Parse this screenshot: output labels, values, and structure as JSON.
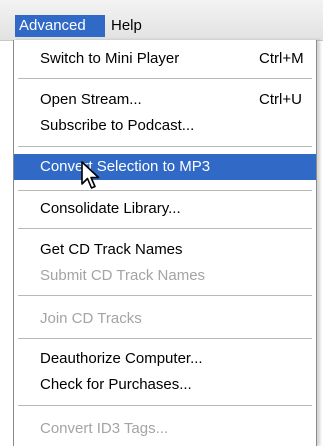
{
  "menubar": {
    "items": [
      {
        "label": "Advanced",
        "active": true
      },
      {
        "label": "Help",
        "active": false
      }
    ]
  },
  "menu": {
    "items": [
      {
        "label": "Switch to Mini Player",
        "shortcut": "Ctrl+M",
        "enabled": true
      },
      {
        "label": "Open Stream...",
        "shortcut": "Ctrl+U",
        "enabled": true
      },
      {
        "label": "Subscribe to Podcast...",
        "shortcut": "",
        "enabled": true
      },
      {
        "label": "Convert Selection to MP3",
        "shortcut": "",
        "enabled": true,
        "highlighted": true
      },
      {
        "label": "Consolidate Library...",
        "shortcut": "",
        "enabled": true
      },
      {
        "label": "Get CD Track Names",
        "shortcut": "",
        "enabled": true
      },
      {
        "label": "Submit CD Track Names",
        "shortcut": "",
        "enabled": false
      },
      {
        "label": "Join CD Tracks",
        "shortcut": "",
        "enabled": false
      },
      {
        "label": "Deauthorize Computer...",
        "shortcut": "",
        "enabled": true
      },
      {
        "label": "Check for Purchases...",
        "shortcut": "",
        "enabled": true
      },
      {
        "label": "Convert ID3 Tags...",
        "shortcut": "",
        "enabled": false
      }
    ]
  },
  "colors": {
    "highlight": "#3169c6",
    "disabled_text": "#a4a4a4",
    "menubar_bg": "#e8e8e8"
  },
  "icons": {
    "cursor": "mouse-pointer-icon"
  }
}
